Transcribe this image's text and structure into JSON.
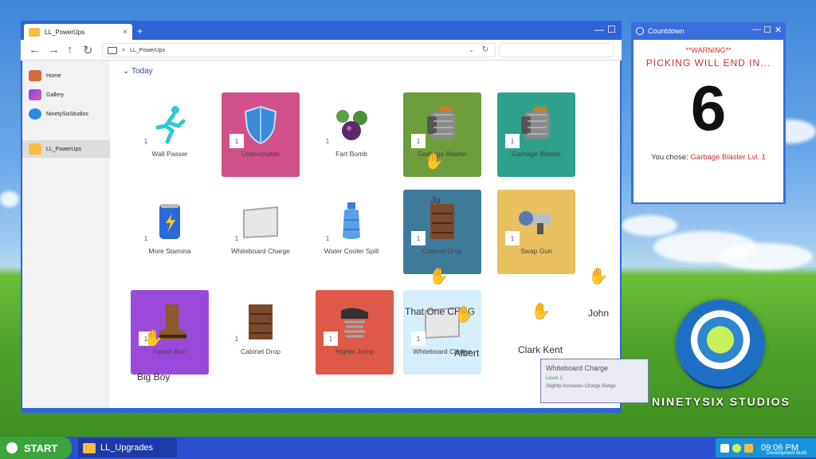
{
  "window": {
    "tab_title": "LL_PowerUps",
    "tab_close": "×",
    "new_tab": "+",
    "minimize": "—",
    "maximize": "☐",
    "address_sep": ">",
    "address": "LL_PowerUps"
  },
  "sidebar": {
    "items": [
      {
        "label": "Home"
      },
      {
        "label": "Gallery"
      },
      {
        "label": "NinetySixStudios"
      },
      {
        "label": "LL_PowerUps"
      }
    ]
  },
  "main": {
    "section": "Today",
    "cards": [
      {
        "name": "Wall Passer",
        "count": "1"
      },
      {
        "name": "Untouchable",
        "count": "1"
      },
      {
        "name": "Fart Bomb",
        "count": "1"
      },
      {
        "name": "Garbage Blaster",
        "count": "1"
      },
      {
        "name": "Garbage Blaster",
        "count": "1"
      },
      {
        "name": "More Stamina",
        "count": "1"
      },
      {
        "name": "Whiteboard Charge",
        "count": "1"
      },
      {
        "name": "Water Cooler Spill",
        "count": "1"
      },
      {
        "name": "Cabinet Drop",
        "count": "1"
      },
      {
        "name": "Swap Gun",
        "count": "1"
      },
      {
        "name": "Faster Run",
        "count": "1"
      },
      {
        "name": "Cabinet Drop",
        "count": "1"
      },
      {
        "name": "Higher Jump",
        "count": "1"
      },
      {
        "name": "Whiteboard Charge",
        "count": "1"
      }
    ],
    "players": [
      "Ju",
      "That One CHAG",
      "John",
      "Albert",
      "Clark Kent",
      "Big Boy"
    ],
    "tooltip": {
      "title": "Whiteboard Charge",
      "level": "Level 1",
      "desc": "Slightly Increases Charge Range"
    }
  },
  "countdown": {
    "title": "Countdown",
    "warning": "**WARNING**",
    "message": "PICKING WILL END IN...",
    "number": "6",
    "chose_label": "You chose:",
    "chose_value": "Garbage Blaster Lvl. 1"
  },
  "logo": {
    "text": "NINETYSIX STUDIOS"
  },
  "taskbar": {
    "start": "START",
    "item": "LL_Upgrades",
    "time": "09:06 PM",
    "dev": "Development Build"
  },
  "colors": {
    "untouchable": "#d2508a",
    "garbage1": "#6e9e3c",
    "garbage2": "#2ea08c",
    "cabinet": "#3e7a9a",
    "swap": "#e8c060",
    "faster": "#9a4ad8",
    "higher": "#dd5a48",
    "whiteboard_selected": "#d6eefa"
  }
}
